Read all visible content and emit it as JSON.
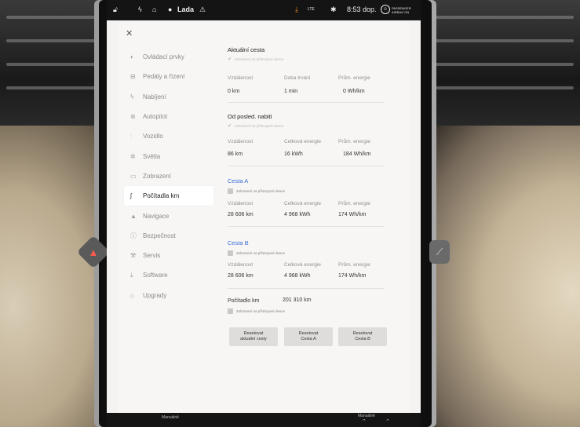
{
  "status": {
    "driver_name": "Lada",
    "lte": "LTE",
    "time": "8:53 dop.",
    "airbag_line1": "PASSENGER",
    "airbag_line2": "AIRBAG ON"
  },
  "nav": [
    {
      "label": "Ovládací prvky",
      "icon": "toggle-icon",
      "glyph": "◐"
    },
    {
      "label": "Pedály a řízení",
      "icon": "car-icon",
      "glyph": "⊟"
    },
    {
      "label": "Nabíjení",
      "icon": "bolt-icon",
      "glyph": "ϟ"
    },
    {
      "label": "Autopilot",
      "icon": "steering-wheel-icon",
      "glyph": "⊛"
    },
    {
      "label": "Vozidlo",
      "icon": "sliders-icon",
      "glyph": "⫶"
    },
    {
      "label": "Světla",
      "icon": "light-icon",
      "glyph": "✲"
    },
    {
      "label": "Zobrazení",
      "icon": "display-icon",
      "glyph": "▭"
    },
    {
      "label": "Počítadla km",
      "icon": "trip-icon",
      "glyph": "ʃ"
    },
    {
      "label": "Navigace",
      "icon": "navigation-icon",
      "glyph": "▲"
    },
    {
      "label": "Bezpečnost",
      "icon": "security-icon",
      "glyph": "ⓘ"
    },
    {
      "label": "Servis",
      "icon": "wrench-icon",
      "glyph": "⚒"
    },
    {
      "label": "Software",
      "icon": "download-icon",
      "glyph": "⤓"
    },
    {
      "label": "Upgrady",
      "icon": "bag-icon",
      "glyph": "⌂"
    }
  ],
  "current_trip": {
    "title": "Aktuální cesta",
    "display_check": "Zobrazení na přístrojové desce",
    "labels": [
      "Vzdálenost",
      "Doba trvání",
      "Prům. energie"
    ],
    "values": [
      "0 km",
      "1 min",
      "0 Wh/km"
    ]
  },
  "since_charge": {
    "title": "Od posled. nabití",
    "display_check": "Zobrazení na přístrojové desce",
    "labels": [
      "Vzdálenost",
      "Celková energie",
      "Prům. energie"
    ],
    "values": [
      "86 km",
      "16 kWh",
      "184 Wh/km"
    ]
  },
  "trip_a": {
    "title": "Cesta A",
    "display_check": "Zobrazení na přístrojové desce",
    "labels": [
      "Vzdálenost",
      "Celková energie",
      "Prům. energie"
    ],
    "values": [
      "28 606 km",
      "4 968 kWh",
      "174 Wh/km"
    ]
  },
  "trip_b": {
    "title": "Cesta B",
    "display_check": "Zobrazení na přístrojové desce",
    "labels": [
      "Vzdálenost",
      "Celková energie",
      "Prům. energie"
    ],
    "values": [
      "28 606 km",
      "4 968 kWh",
      "174 Wh/km"
    ]
  },
  "odometer": {
    "label": "Počítadlo km",
    "value": "201 310 km",
    "display_check": "Zobrazení na přístrojové desce"
  },
  "buttons": {
    "reset_current_1": "Resetovat",
    "reset_current_2": "aktuální cesty",
    "reset_a_1": "Resetovat",
    "reset_a_2": "Cesta A",
    "reset_b_1": "Resetovat",
    "reset_b_2": "Cesta B"
  },
  "bottom": {
    "left_label": "Manuálně",
    "right_label": "Manuálně"
  },
  "colors": {
    "accent": "#3e6fd8",
    "active_bg": "#ffffff",
    "panel_bg": "#f7f6f4"
  }
}
